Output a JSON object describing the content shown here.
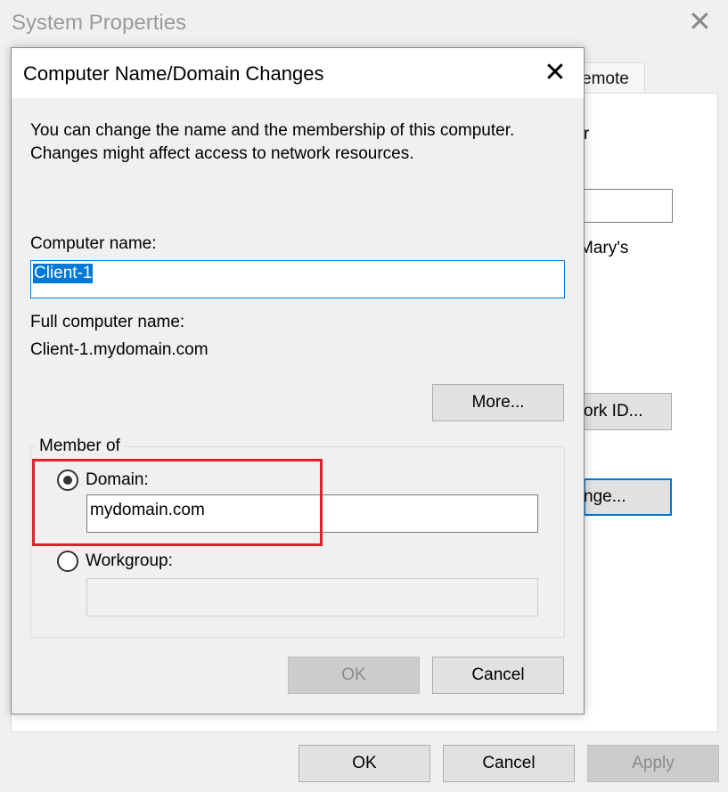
{
  "background_window": {
    "title": "System Properties",
    "close_glyph": "✕",
    "tab_fragment": "emote",
    "text_fragment_r": "r",
    "text_fragment_mary": "Mary's",
    "network_id_fragment": "ork ID...",
    "change_fragment": "nge...",
    "ok_label": "OK",
    "cancel_label": "Cancel",
    "apply_label": "Apply"
  },
  "dialog": {
    "title": "Computer Name/Domain Changes",
    "close_glyph": "✕",
    "description": "You can change the name and the membership of this computer. Changes might affect access to network resources.",
    "computer_name_label": "Computer name:",
    "computer_name_value": "Client-1",
    "full_name_label": "Full computer name:",
    "full_name_value": "Client-1.mydomain.com",
    "more_label": "More...",
    "member_of_label": "Member of",
    "domain_label": "Domain:",
    "domain_value": "mydomain.com",
    "domain_selected": true,
    "workgroup_label": "Workgroup:",
    "workgroup_value": "",
    "ok_label": "OK",
    "cancel_label": "Cancel"
  },
  "colors": {
    "accent": "#0078d7",
    "highlight": "#e0202a"
  }
}
